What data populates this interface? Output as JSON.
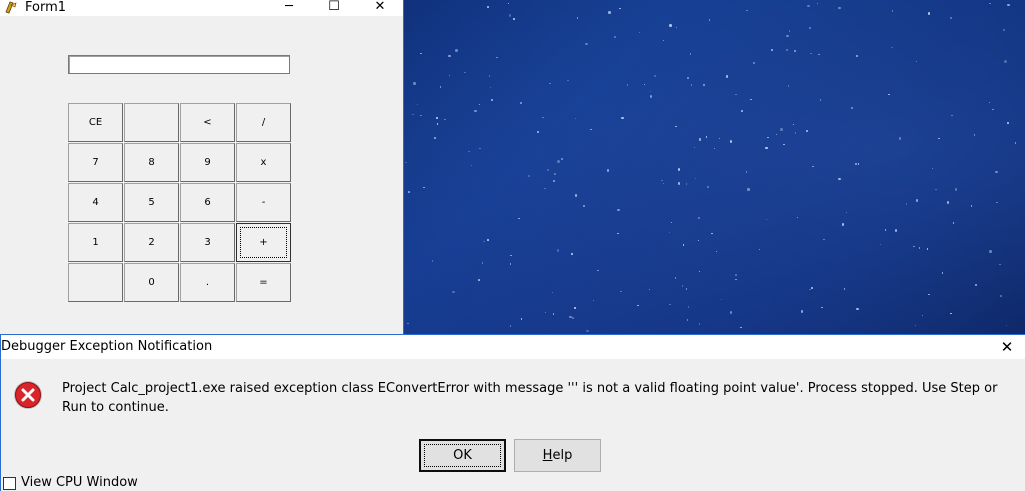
{
  "form1": {
    "title": "Form1",
    "controls": {
      "minimize": "─",
      "maximize": "☐",
      "close": "✕"
    },
    "display_value": "",
    "buttons": [
      [
        "CE",
        "",
        "<",
        "/"
      ],
      [
        "7",
        "8",
        "9",
        "x"
      ],
      [
        "4",
        "5",
        "6",
        "-"
      ],
      [
        "1",
        "2",
        "3",
        "+"
      ],
      [
        "",
        "0",
        ".",
        "="
      ]
    ]
  },
  "dialog": {
    "title": "Debugger Exception Notification",
    "close": "✕",
    "icon": "error-icon",
    "message": "Project Calc_project1.exe raised exception class EConvertError with message ''' is not a valid floating point value'. Process stopped. Use Step or Run to continue.",
    "ok_label": "OK",
    "help_label": "Help",
    "checkbox_label": "View CPU Window",
    "checkbox_checked": false
  },
  "colors": {
    "desktop": "#0d2b72",
    "window_border": "#2b6cd0",
    "error_red": "#d9252a"
  }
}
